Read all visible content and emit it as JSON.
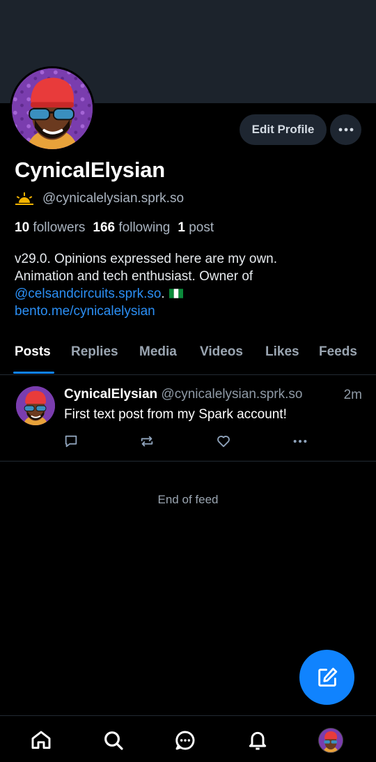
{
  "profile": {
    "display_name": "CynicalElysian",
    "handle": "@cynicalelysian.sprk.so",
    "followers_count": "10",
    "followers_label": "followers",
    "following_count": "166",
    "following_label": "following",
    "posts_count": "1",
    "posts_label": "post",
    "bio_line1": "v29.0. Opinions expressed here are my own.",
    "bio_line2": "Animation and tech enthusiast. Owner of",
    "bio_mention": "@celsandcircuits.sprk.so",
    "bio_after_mention": ".",
    "bio_link": "bento.me/cynicalelysian"
  },
  "actions": {
    "edit_profile_label": "Edit Profile",
    "more_icon": "more-horizontal-icon"
  },
  "tabs": [
    {
      "label": "Posts",
      "active": true
    },
    {
      "label": "Replies"
    },
    {
      "label": "Media"
    },
    {
      "label": "Videos"
    },
    {
      "label": "Likes"
    },
    {
      "label": "Feeds"
    }
  ],
  "post": {
    "author_name": "CynicalElysian",
    "author_handle": "@cynicalelysian.sprk.so",
    "time": "2m",
    "text": "First text post from my Spark account!"
  },
  "feed": {
    "end_text": "End of feed"
  },
  "nav": [
    "home-icon",
    "search-icon",
    "chat-icon",
    "bell-icon",
    "profile-avatar"
  ],
  "colors": {
    "accent": "#1083fe",
    "link": "#2b8ff5",
    "banner": "#1c232c",
    "button_bg": "#1e2631",
    "muted_text": "#aab4c0"
  }
}
